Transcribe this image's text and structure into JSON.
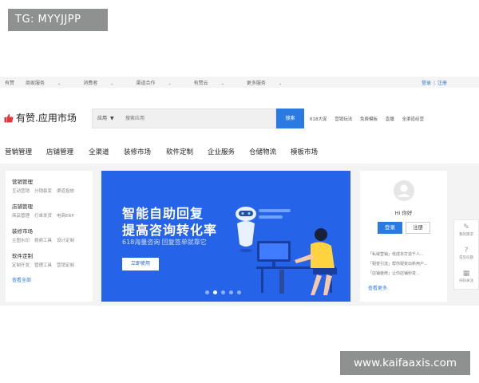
{
  "badge": {
    "text": "TG: MYYJJPP"
  },
  "topbar": {
    "items": [
      "有赞",
      "商家服务",
      "消费者",
      "渠道合作",
      "有赞云",
      "更多服务"
    ],
    "login": "登录",
    "register": "注册",
    "separator": "|"
  },
  "header": {
    "logo_text": "有赞.应用市场",
    "search": {
      "scope": "应用",
      "placeholder": "搜索应用",
      "button": "搜索"
    },
    "hot_tags": [
      "618大促",
      "营销玩法",
      "免费模板",
      "直播",
      "全渠道经营"
    ]
  },
  "mainnav": {
    "items": [
      "营销管理",
      "店铺管理",
      "全渠道",
      "装修市场",
      "软件定制",
      "企业服务",
      "仓储物流",
      "模板市场"
    ]
  },
  "leftpanel": {
    "categories": [
      {
        "title": "营销管理",
        "links": [
          "互动营销",
          "分销裂变",
          "渠道投放"
        ]
      },
      {
        "title": "店铺管理",
        "links": [
          "商品管理",
          "打单发货",
          "电商ERP"
        ]
      },
      {
        "title": "装修市场",
        "links": [
          "主图水印",
          "视频工具",
          "设计定制"
        ]
      },
      {
        "title": "软件定制",
        "links": [
          "定制开发",
          "管理工具",
          "营销定制"
        ]
      }
    ],
    "more": "查看全部"
  },
  "banner": {
    "headline1": "智能自助回复",
    "headline2": "提高咨询转化率",
    "subtitle": "618海量咨询 回复签单就靠它",
    "cta": "立即使用",
    "active_slide": 2,
    "slide_count": 5
  },
  "rightpanel": {
    "greeting": "Hi 你好",
    "login": "登录",
    "register": "注册",
    "news": [
      "「私域营销」低成本打造千人...",
      "「裂变引流」帮你裂变出新用户...",
      "「店铺装修」让你店铺秒变..."
    ],
    "more": "查看更多"
  },
  "sidetools": [
    {
      "icon": "feedback-icon",
      "label": "我的需求"
    },
    {
      "icon": "help-icon",
      "label": "常见问题"
    },
    {
      "icon": "qrcode-icon",
      "label": "扫码关注"
    }
  ],
  "watermark": {
    "text": "www.kaifaaxis.com"
  },
  "colors": {
    "accent": "#2a7ae2",
    "banner": "#2563e8",
    "logo_red": "#e4393c"
  }
}
